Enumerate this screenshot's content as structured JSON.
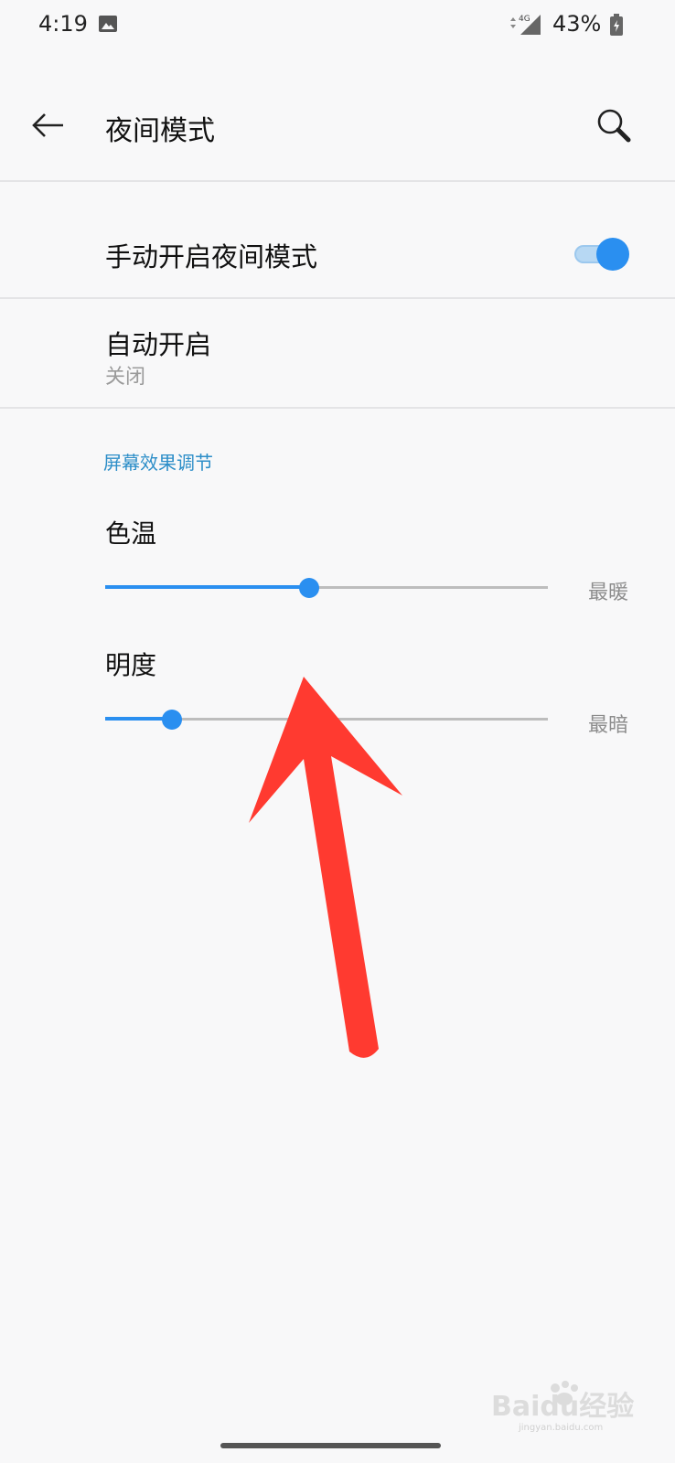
{
  "status_bar": {
    "time": "4:19",
    "network": "4G",
    "battery_percent": "43%",
    "icons": [
      "gallery-icon",
      "signal-icon",
      "battery-icon"
    ]
  },
  "header": {
    "title": "夜间模式",
    "back_icon": "back-arrow-icon",
    "search_icon": "search-icon"
  },
  "settings": {
    "manual_toggle": {
      "label": "手动开启夜间模式",
      "on": true
    },
    "auto_enable": {
      "label": "自动开启",
      "value": "关闭"
    }
  },
  "screen_adjust": {
    "section_title": "屏幕效果调节",
    "color_temperature": {
      "label": "色温",
      "end_label": "最暖",
      "value_fraction": 0.46
    },
    "brightness": {
      "label": "明度",
      "end_label": "最暗",
      "value_fraction": 0.15
    }
  },
  "colors": {
    "accent": "#2a8ff0",
    "section_header": "#2d8ec8",
    "annotation_arrow": "#ff3a30"
  },
  "watermark": {
    "text": "Baidu经验",
    "subtext": "jingyan.baidu.com"
  }
}
